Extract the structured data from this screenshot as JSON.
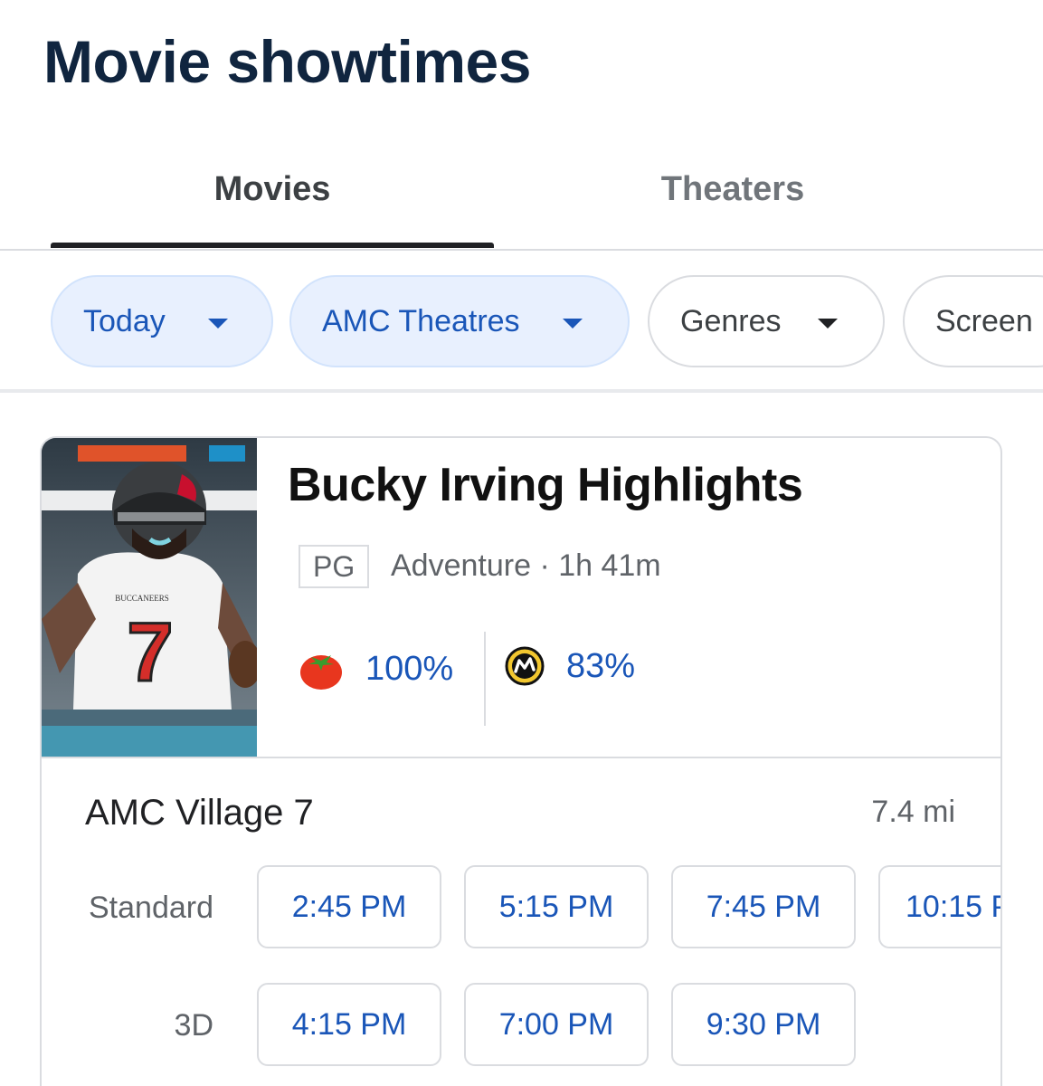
{
  "page": {
    "title": "Movie showtimes"
  },
  "tabs": [
    {
      "label": "Movies",
      "active": true
    },
    {
      "label": "Theaters",
      "active": false
    }
  ],
  "filters": [
    {
      "label": "Today",
      "active": true
    },
    {
      "label": "AMC Theatres",
      "active": true
    },
    {
      "label": "Genres",
      "active": false
    },
    {
      "label": "Screen",
      "active": false
    }
  ],
  "movie": {
    "title": "Bucky Irving Highlights",
    "rating": "PG",
    "meta": "Adventure · 1h 41m",
    "poster": {
      "team_text": "BUCCANEERS",
      "jersey_number": "7"
    },
    "scores": {
      "tomatometer": {
        "icon": "tomato-icon",
        "value": "100%"
      },
      "metacritic": {
        "icon": "metacritic-icon",
        "value": "83%"
      }
    }
  },
  "theater": {
    "name": "AMC Village 7",
    "distance": "7.4 mi",
    "formats": [
      {
        "label": "Standard",
        "times": [
          "2:45 PM",
          "5:15 PM",
          "7:45 PM",
          "10:15 P"
        ]
      },
      {
        "label": "3D",
        "times": [
          "4:15 PM",
          "7:00 PM",
          "9:30 PM"
        ]
      }
    ]
  },
  "colors": {
    "title": "#10253f",
    "accent_blue": "#1a56b8",
    "chip_active_bg": "#e8f0fe",
    "border": "#dadce0",
    "tomato_red": "#e8361e",
    "metacritic_yellow": "#f2c72f"
  }
}
